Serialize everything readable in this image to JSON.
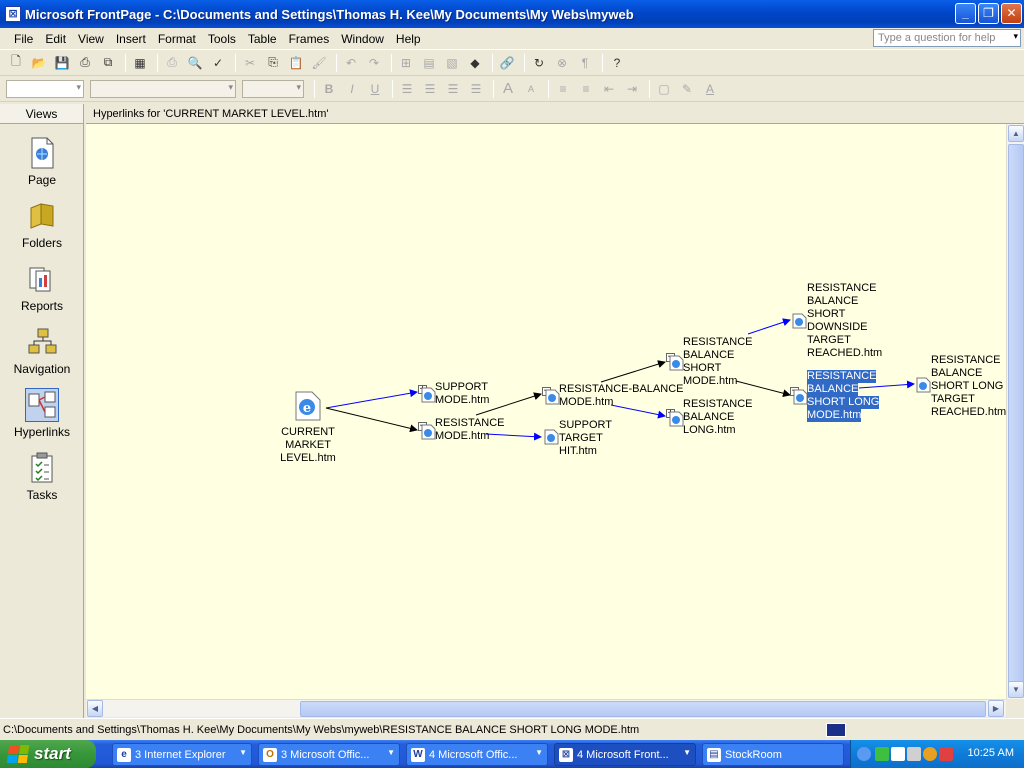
{
  "window": {
    "title": "Microsoft FrontPage - C:\\Documents and Settings\\Thomas H. Kee\\My Documents\\My Webs\\myweb"
  },
  "menu": [
    "File",
    "Edit",
    "View",
    "Insert",
    "Format",
    "Tools",
    "Table",
    "Frames",
    "Window",
    "Help"
  ],
  "ask_placeholder": "Type a question for help",
  "views": {
    "header": "Views",
    "items": [
      "Page",
      "Folders",
      "Reports",
      "Navigation",
      "Hyperlinks",
      "Tasks"
    ],
    "selected": "Hyperlinks"
  },
  "content_header": "Hyperlinks for 'CURRENT MARKET LEVEL.htm'",
  "nodes": {
    "current": [
      "CURRENT MARKET",
      "LEVEL.htm"
    ],
    "support_mode": [
      "SUPPORT",
      "MODE.htm"
    ],
    "resistance_mode": [
      "RESISTANCE",
      "MODE.htm"
    ],
    "resistance_balance_mode": [
      "RESISTANCE-BALANCE",
      "MODE.htm"
    ],
    "support_target_hit": [
      "SUPPORT",
      "TARGET",
      "HIT.htm"
    ],
    "rb_short_mode": [
      "RESISTANCE",
      "BALANCE",
      "SHORT",
      "MODE.htm"
    ],
    "rb_long": [
      "RESISTANCE",
      "BALANCE",
      "LONG.htm"
    ],
    "rb_short_downside": [
      "RESISTANCE",
      "BALANCE",
      "SHORT",
      "DOWNSIDE",
      "TARGET",
      "REACHED.htm"
    ],
    "rb_short_long_mode": [
      "RESISTANCE",
      "BALANCE",
      "SHORT LONG",
      "MODE.htm"
    ],
    "rb_short_long_target": [
      "RESISTANCE",
      "BALANCE",
      "SHORT LONG",
      "TARGET",
      "REACHED.htm"
    ]
  },
  "status_text": "C:\\Documents and Settings\\Thomas H. Kee\\My Documents\\My Webs\\myweb\\RESISTANCE BALANCE SHORT LONG MODE.htm",
  "taskbar": {
    "start": "start",
    "buttons": [
      "3 Internet Explorer",
      "3 Microsoft Offic...",
      "4 Microsoft Offic...",
      "4 Microsoft Front...",
      "StockRoom"
    ],
    "clock": "10:25 AM"
  },
  "colors": {
    "canvas_bg": "#ffffe1",
    "link_blue": "#0000ff",
    "link_black": "#000000",
    "selection": "#316ac5",
    "title_bar": "#0a5fe8"
  }
}
